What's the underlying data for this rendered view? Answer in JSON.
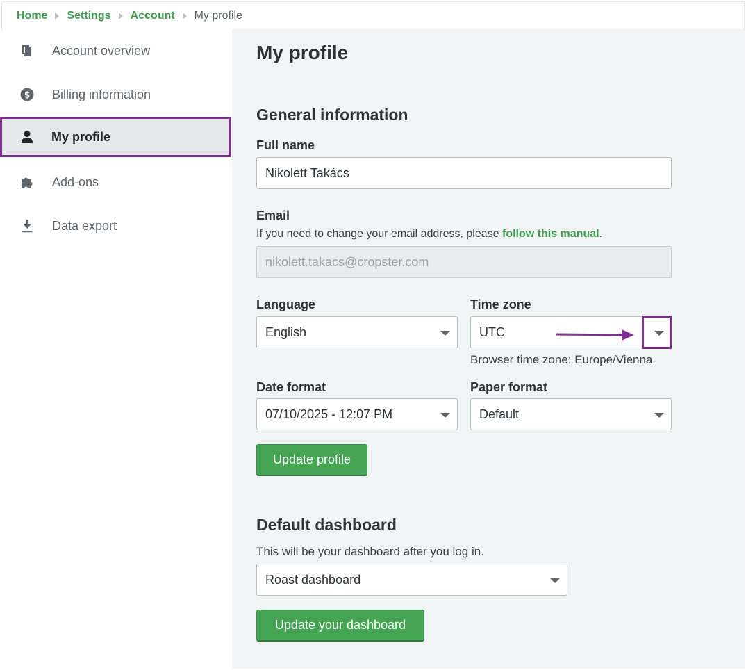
{
  "breadcrumb": {
    "items": [
      "Home",
      "Settings",
      "Account"
    ],
    "current": "My profile"
  },
  "sidebar": {
    "items": [
      {
        "label": "Account overview",
        "icon": "book-icon"
      },
      {
        "label": "Billing information",
        "icon": "dollar-icon"
      },
      {
        "label": "My profile",
        "icon": "user-icon",
        "active": true
      },
      {
        "label": "Add-ons",
        "icon": "puzzle-icon"
      },
      {
        "label": "Data export",
        "icon": "download-icon"
      }
    ]
  },
  "main": {
    "title": "My profile",
    "general": {
      "title": "General information",
      "full_name_label": "Full name",
      "full_name_value": "Nikolett Takács",
      "email_label": "Email",
      "email_help_prefix": "If you need to change your email address, please ",
      "email_help_link": "follow this manual",
      "email_help_suffix": ".",
      "email_value": "nikolett.takacs@cropster.com",
      "language_label": "Language",
      "language_value": "English",
      "timezone_label": "Time zone",
      "timezone_value": "UTC",
      "browser_tz": "Browser time zone: Europe/Vienna",
      "date_format_label": "Date format",
      "date_format_value": "07/10/2025 - 12:07 PM",
      "paper_format_label": "Paper format",
      "paper_format_value": "Default",
      "update_button": "Update profile"
    },
    "dashboard": {
      "title": "Default dashboard",
      "help": "This will be your dashboard after you log in.",
      "value": "Roast dashboard",
      "update_button": "Update your dashboard"
    }
  },
  "colors": {
    "accent_green": "#45a554",
    "highlight_purple": "#7e2e8e"
  }
}
